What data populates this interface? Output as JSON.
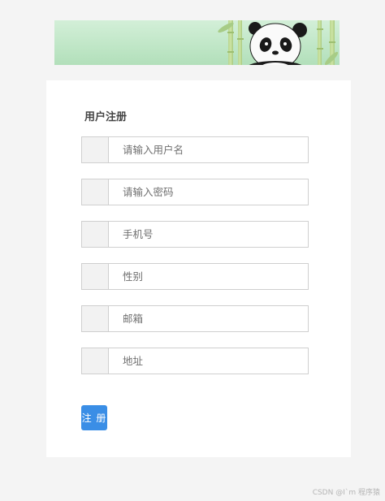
{
  "form": {
    "title": "用户注册",
    "fields": [
      {
        "placeholder": "请输入用户名"
      },
      {
        "placeholder": "请输入密码"
      },
      {
        "placeholder": "手机号"
      },
      {
        "placeholder": "性别"
      },
      {
        "placeholder": "邮箱"
      },
      {
        "placeholder": "地址"
      }
    ],
    "submit_label": "注 册"
  },
  "watermark": "CSDN @I`m 程序猿",
  "colors": {
    "page_background": "#f4f4f4",
    "banner_green": "#bfe6c6",
    "submit_blue": "#3a8ee6"
  },
  "banner": {
    "icon": "panda-bamboo-illustration"
  }
}
